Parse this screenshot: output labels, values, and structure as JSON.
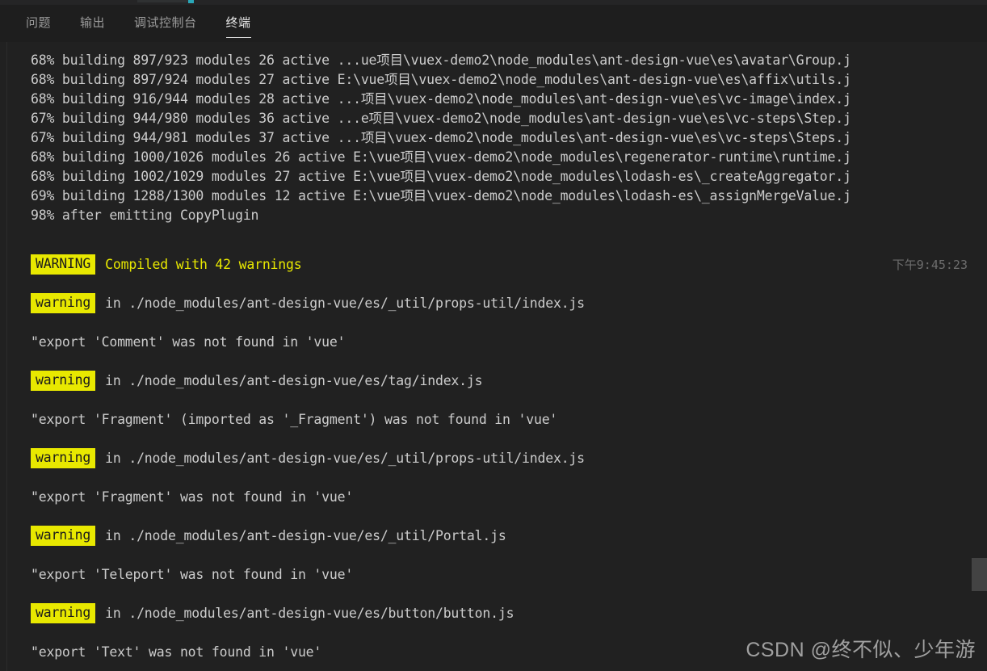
{
  "window": {
    "background_color": "#212121",
    "accent_color": "#2aa7b8"
  },
  "tabs": [
    {
      "id": "problems",
      "label": "问题",
      "active": false
    },
    {
      "id": "output",
      "label": "输出",
      "active": false
    },
    {
      "id": "debug-console",
      "label": "调试控制台",
      "active": false
    },
    {
      "id": "terminal",
      "label": "终端",
      "active": true
    }
  ],
  "terminal": {
    "build_lines": [
      "68% building 897/923 modules 26 active ...ue项目\\vuex-demo2\\node_modules\\ant-design-vue\\es\\avatar\\Group.j",
      "68% building 897/924 modules 27 active E:\\vue项目\\vuex-demo2\\node_modules\\ant-design-vue\\es\\affix\\utils.j",
      "68% building 916/944 modules 28 active ...项目\\vuex-demo2\\node_modules\\ant-design-vue\\es\\vc-image\\index.j",
      "67% building 944/980 modules 36 active ...e项目\\vuex-demo2\\node_modules\\ant-design-vue\\es\\vc-steps\\Step.j",
      "67% building 944/981 modules 37 active ...项目\\vuex-demo2\\node_modules\\ant-design-vue\\es\\vc-steps\\Steps.j",
      "68% building 1000/1026 modules 26 active E:\\vue项目\\vuex-demo2\\node_modules\\regenerator-runtime\\runtime.j",
      "68% building 1002/1029 modules 27 active E:\\vue项目\\vuex-demo2\\node_modules\\lodash-es\\_createAggregator.j",
      "69% building 1288/1300 modules 12 active E:\\vue项目\\vuex-demo2\\node_modules\\lodash-es\\_assignMergeValue.j",
      "98% after emitting CopyPlugin"
    ],
    "summary": {
      "badge": "WARNING",
      "text": "Compiled with 42 warnings",
      "timestamp": "下午9:45:23"
    },
    "warnings": [
      {
        "badge": "warning",
        "location": "in ./node_modules/ant-design-vue/es/_util/props-util/index.js",
        "message": "\"export 'Comment' was not found in 'vue'"
      },
      {
        "badge": "warning",
        "location": "in ./node_modules/ant-design-vue/es/tag/index.js",
        "message": "\"export 'Fragment' (imported as '_Fragment') was not found in 'vue'"
      },
      {
        "badge": "warning",
        "location": "in ./node_modules/ant-design-vue/es/_util/props-util/index.js",
        "message": "\"export 'Fragment' was not found in 'vue'"
      },
      {
        "badge": "warning",
        "location": "in ./node_modules/ant-design-vue/es/_util/Portal.js",
        "message": "\"export 'Teleport' was not found in 'vue'"
      },
      {
        "badge": "warning",
        "location": "in ./node_modules/ant-design-vue/es/button/button.js",
        "message": "\"export 'Text' was not found in 'vue'"
      }
    ]
  },
  "watermark": "CSDN @终不似、少年游"
}
